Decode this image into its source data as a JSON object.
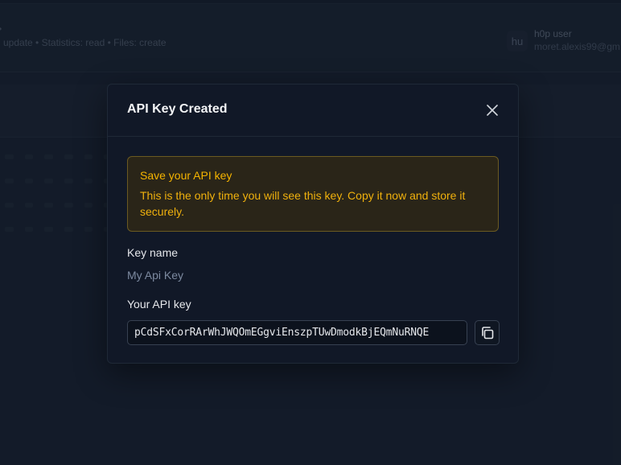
{
  "background": {
    "permissions_text": "update • Statistics: read • Files: create",
    "user": {
      "avatar_initials": "hu",
      "name": "h0p user",
      "email": "moret.alexis99@gm"
    }
  },
  "modal": {
    "title": "API Key Created",
    "close_icon": "close-icon",
    "warning": {
      "title": "Save your API key",
      "text": "This is the only time you will see this key. Copy it now and store it securely."
    },
    "key_name": {
      "label": "Key name",
      "value": "My Api Key"
    },
    "api_key": {
      "label": "Your API key",
      "value": "pCdSFxCorRArWhJWQOmEGgviEnszpTUwDmodkBjEQmNuRNQE",
      "copy_icon": "copy-icon"
    }
  },
  "colors": {
    "modal_bg": "#111827",
    "warning_bg": "#2a2518",
    "warning_border": "#6b5a21",
    "warning_text": "#f5b400"
  }
}
